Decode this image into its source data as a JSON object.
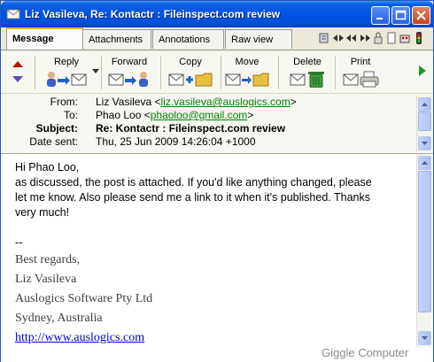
{
  "window": {
    "title": "Liz Vasileva, Re: Kontactr : Fileinspect.com review"
  },
  "tabs": [
    {
      "label": "Message",
      "active": true
    },
    {
      "label": "Attachments",
      "active": false
    },
    {
      "label": "Annotations",
      "active": false
    },
    {
      "label": "Raw view",
      "active": false
    }
  ],
  "toolbar": {
    "reply": "Reply",
    "forward": "Forward",
    "copy": "Copy",
    "move": "Move",
    "delete": "Delete",
    "print": "Print"
  },
  "headers": {
    "from_label": "From:",
    "from_name": "Liz Vasileva <",
    "from_email": "liz.vasileva@auslogics.com",
    "from_close": ">",
    "to_label": "To:",
    "to_name": "Phao Loo <",
    "to_email": "phaoloo@gmail.com",
    "to_close": ">",
    "subject_label": "Subject:",
    "subject": "Re: Kontactr : Fileinspect.com review",
    "date_label": "Date sent:",
    "date": "Thu, 25 Jun 2009 14:26:04 +1000"
  },
  "body": {
    "greeting": "Hi Phao Loo,",
    "line1": "as discussed, the post is attached. If you'd like anything changed, please",
    "line2": "let me know. Also please send me a link to it when it's published. Thanks",
    "line3": "very much!",
    "sig_dash": "--",
    "sig1": "Best regards,",
    "sig2": "Liz Vasileva",
    "sig3": "Auslogics Software Pty Ltd",
    "sig4": "Sydney, Australia",
    "sig_link": "http://www.auslogics.com"
  },
  "watermark": "Giggle Computer",
  "colors": {
    "titlebar": "#0054e3",
    "link_green": "#008000",
    "link_blue": "#0000ee"
  }
}
